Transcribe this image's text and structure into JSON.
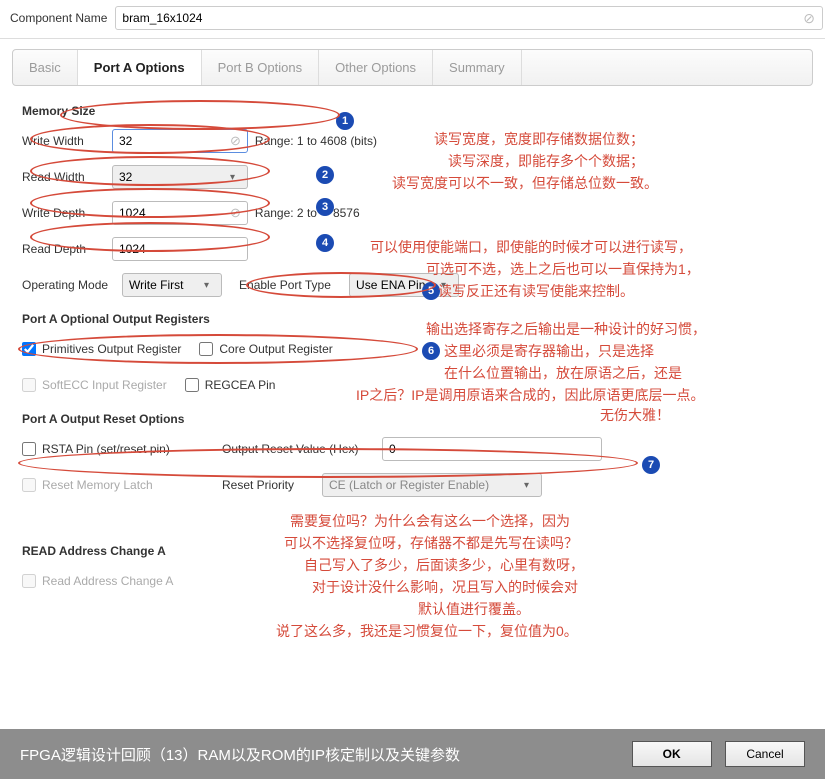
{
  "header": {
    "label": "Component Name",
    "value": "bram_16x1024"
  },
  "tabs": [
    "Basic",
    "Port A Options",
    "Port B Options",
    "Other Options",
    "Summary"
  ],
  "active_tab": 1,
  "sections": {
    "mem": {
      "title": "Memory Size",
      "rows": {
        "ww": {
          "label": "Write Width",
          "value": "32",
          "range": "Range: 1 to 4608 (bits)"
        },
        "rw": {
          "label": "Read Width",
          "value": "32"
        },
        "wd": {
          "label": "Write Depth",
          "value": "1024",
          "range_prefix": "Range: 2 to",
          "range_suffix": "8576"
        },
        "rd": {
          "label": "Read Depth",
          "value": "1024"
        }
      }
    },
    "mode": {
      "label": "Operating Mode",
      "value": "Write First"
    },
    "ept": {
      "label": "Enable Port Type",
      "value": "Use ENA Pin"
    },
    "outreg": {
      "title": "Port A Optional Output Registers",
      "primitives": "Primitives Output Register",
      "core": "Core Output Register",
      "softecc": "SoftECC Input Register",
      "regcea": "REGCEA Pin"
    },
    "reset": {
      "title": "Port A Output Reset Options",
      "rsta": "RSTA Pin (set/reset pin)",
      "orv_label": "Output Reset Value (Hex)",
      "orv_value": "0",
      "rml": "Reset Memory Latch",
      "rp_label": "Reset Priority",
      "rp_value": "CE (Latch or Register Enable)"
    },
    "read_addr": {
      "title": "READ Address Change A",
      "opt": "Read Address Change A"
    }
  },
  "notes": {
    "n1a": "读写宽度，宽度即存储数据位数；",
    "n1b": "读写深度，即能存多个个数据；",
    "n1c": "读写宽度可以不一致，但存储总位数一致。",
    "n2a": "可以使用使能端口，即使能的时候才可以进行读写，",
    "n2b": "可选可不选，选上之后也可以一直保持为1，",
    "n2c": "读写反正还有读写使能来控制。",
    "n3a": "输出选择寄存之后输出是一种设计的好习惯，",
    "n3b": "这里必须是寄存器输出，只是选择",
    "n3c": "在什么位置输出，放在原语之后，还是",
    "n3d": "IP之后？IP是调用原语来合成的，因此原语更底层一点。",
    "n3e": "无伤大雅！",
    "n4a": "需要复位吗？为什么会有这么一个选择，因为",
    "n4b": "可以不选择复位呀，存储器不都是先写在读吗？",
    "n4c": "自己写入了多少，后面读多少，心里有数呀，",
    "n4d": "对于设计没什么影响，况且写入的时候会对",
    "n4e": "默认值进行覆盖。",
    "n4f": "说了这么多，我还是习惯复位一下，复位值为0。"
  },
  "badges": [
    "1",
    "2",
    "3",
    "4",
    "5",
    "6",
    "7"
  ],
  "footer": {
    "text": "FPGA逻辑设计回顾（13）RAM以及ROM的IP核定制以及关键参数",
    "ok": "OK",
    "cancel": "Cancel"
  }
}
